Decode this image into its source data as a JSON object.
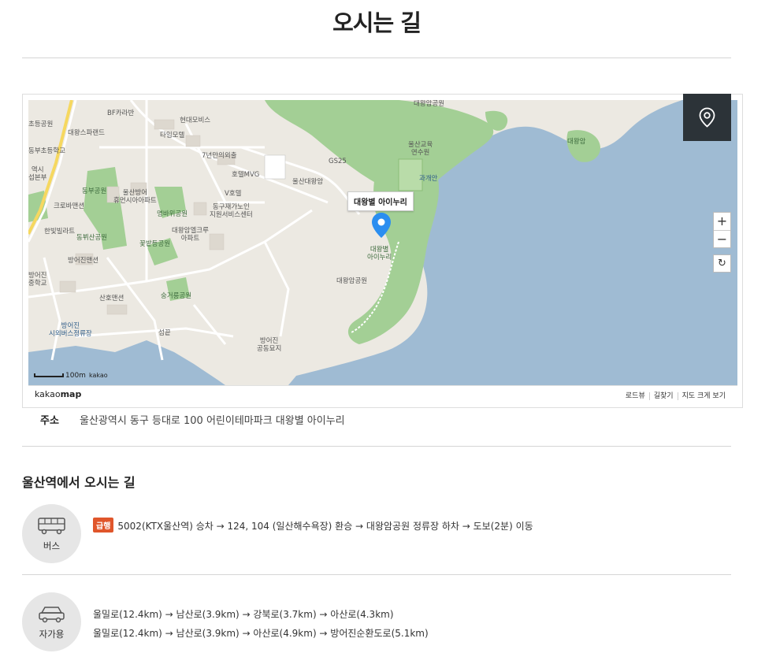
{
  "page": {
    "title": "오시는 길"
  },
  "map": {
    "callout": "대왕별 아이누리",
    "zoom_in": "+",
    "zoom_out": "−",
    "reset": "↻",
    "scale_label": "100m",
    "scale_brand": "kakao",
    "logo_light": "kakao",
    "logo_bold": "map",
    "footer_links": [
      "로드뷰",
      "길찾기",
      "지도 크게 보기"
    ],
    "labels": {
      "bf_karaban": "BF카라반",
      "hyundai_mobis": "현대모비스",
      "taim_hotel": "타임모텔",
      "daewang_spa": "대왕스파랜드",
      "seven_year": "7년만의외출",
      "hotel_mvg": "호텔MVG",
      "v_hotel": "V호텔",
      "gs25": "GS25",
      "ulsan_daewangam": "울산대왕암",
      "ulsan_edu": "울산교육\n연수원",
      "daewangam_top": "대왕암공원",
      "daewangam_island": "대왕암",
      "gwaegaein": "과개안",
      "donggu_center": "동구재가노인\n지원서비스센터",
      "ulsan_bangeo": "울산방어\n휴먼시아아파트",
      "dongbu_park": "동부공원",
      "myeongbawi": "명바위공원",
      "daewangam_apt": "대왕암엘크루\n아파트",
      "kkotbat": "꽃밭등공원",
      "crowbar": "크로바맨션",
      "hanbit": "한빛빌라트",
      "dongbu_park2": "동뷔산공원",
      "bangeojin_mansion": "방어진맨션",
      "sanho": "산호맨션",
      "songgeotdeung": "숭거릉공원",
      "bangeojin_terminal": "방어진\n시외버스정류장",
      "seomkkeut": "섬끝",
      "bangeojin_cemetery": "방어진\n공동묘지",
      "daewangam_park": "대왕암공원",
      "aiinuri_on_map": "대왕별\n아이누리",
      "dongbu_school": "동부초등학교",
      "yeoksi": "역시\n섭본부",
      "bangeojin_school": "방어진\n중학교",
      "chodeung_park": "초등공원"
    }
  },
  "address": {
    "label": "주소",
    "value": "울산광역시 동구 등대로 100 어린이테마파크 대왕별 아이누리"
  },
  "directions": {
    "title": "울산역에서 오시는 길",
    "bus": {
      "label": "버스",
      "badge": "급행",
      "route": "5002(KTX울산역) 승차 → 124, 104 (일산해수욕장) 환승 → 대왕암공원 정류장 하차 → 도보(2분) 이동"
    },
    "car": {
      "label": "자가용",
      "routes": [
        "울밀로(12.4km) → 남산로(3.9km) → 강북로(3.7km) → 아산로(4.3km)",
        "울밀로(12.4km) → 남산로(3.9km) → 아산로(4.9km) → 방어진순환도로(5.1km)"
      ]
    }
  },
  "colors": {
    "sea": "#9fbbd3",
    "park": "#a3cf95",
    "land": "#ece9e2",
    "badge": "#e0562b",
    "pin": "#2b8ef0",
    "loc_button": "#2c3338"
  }
}
